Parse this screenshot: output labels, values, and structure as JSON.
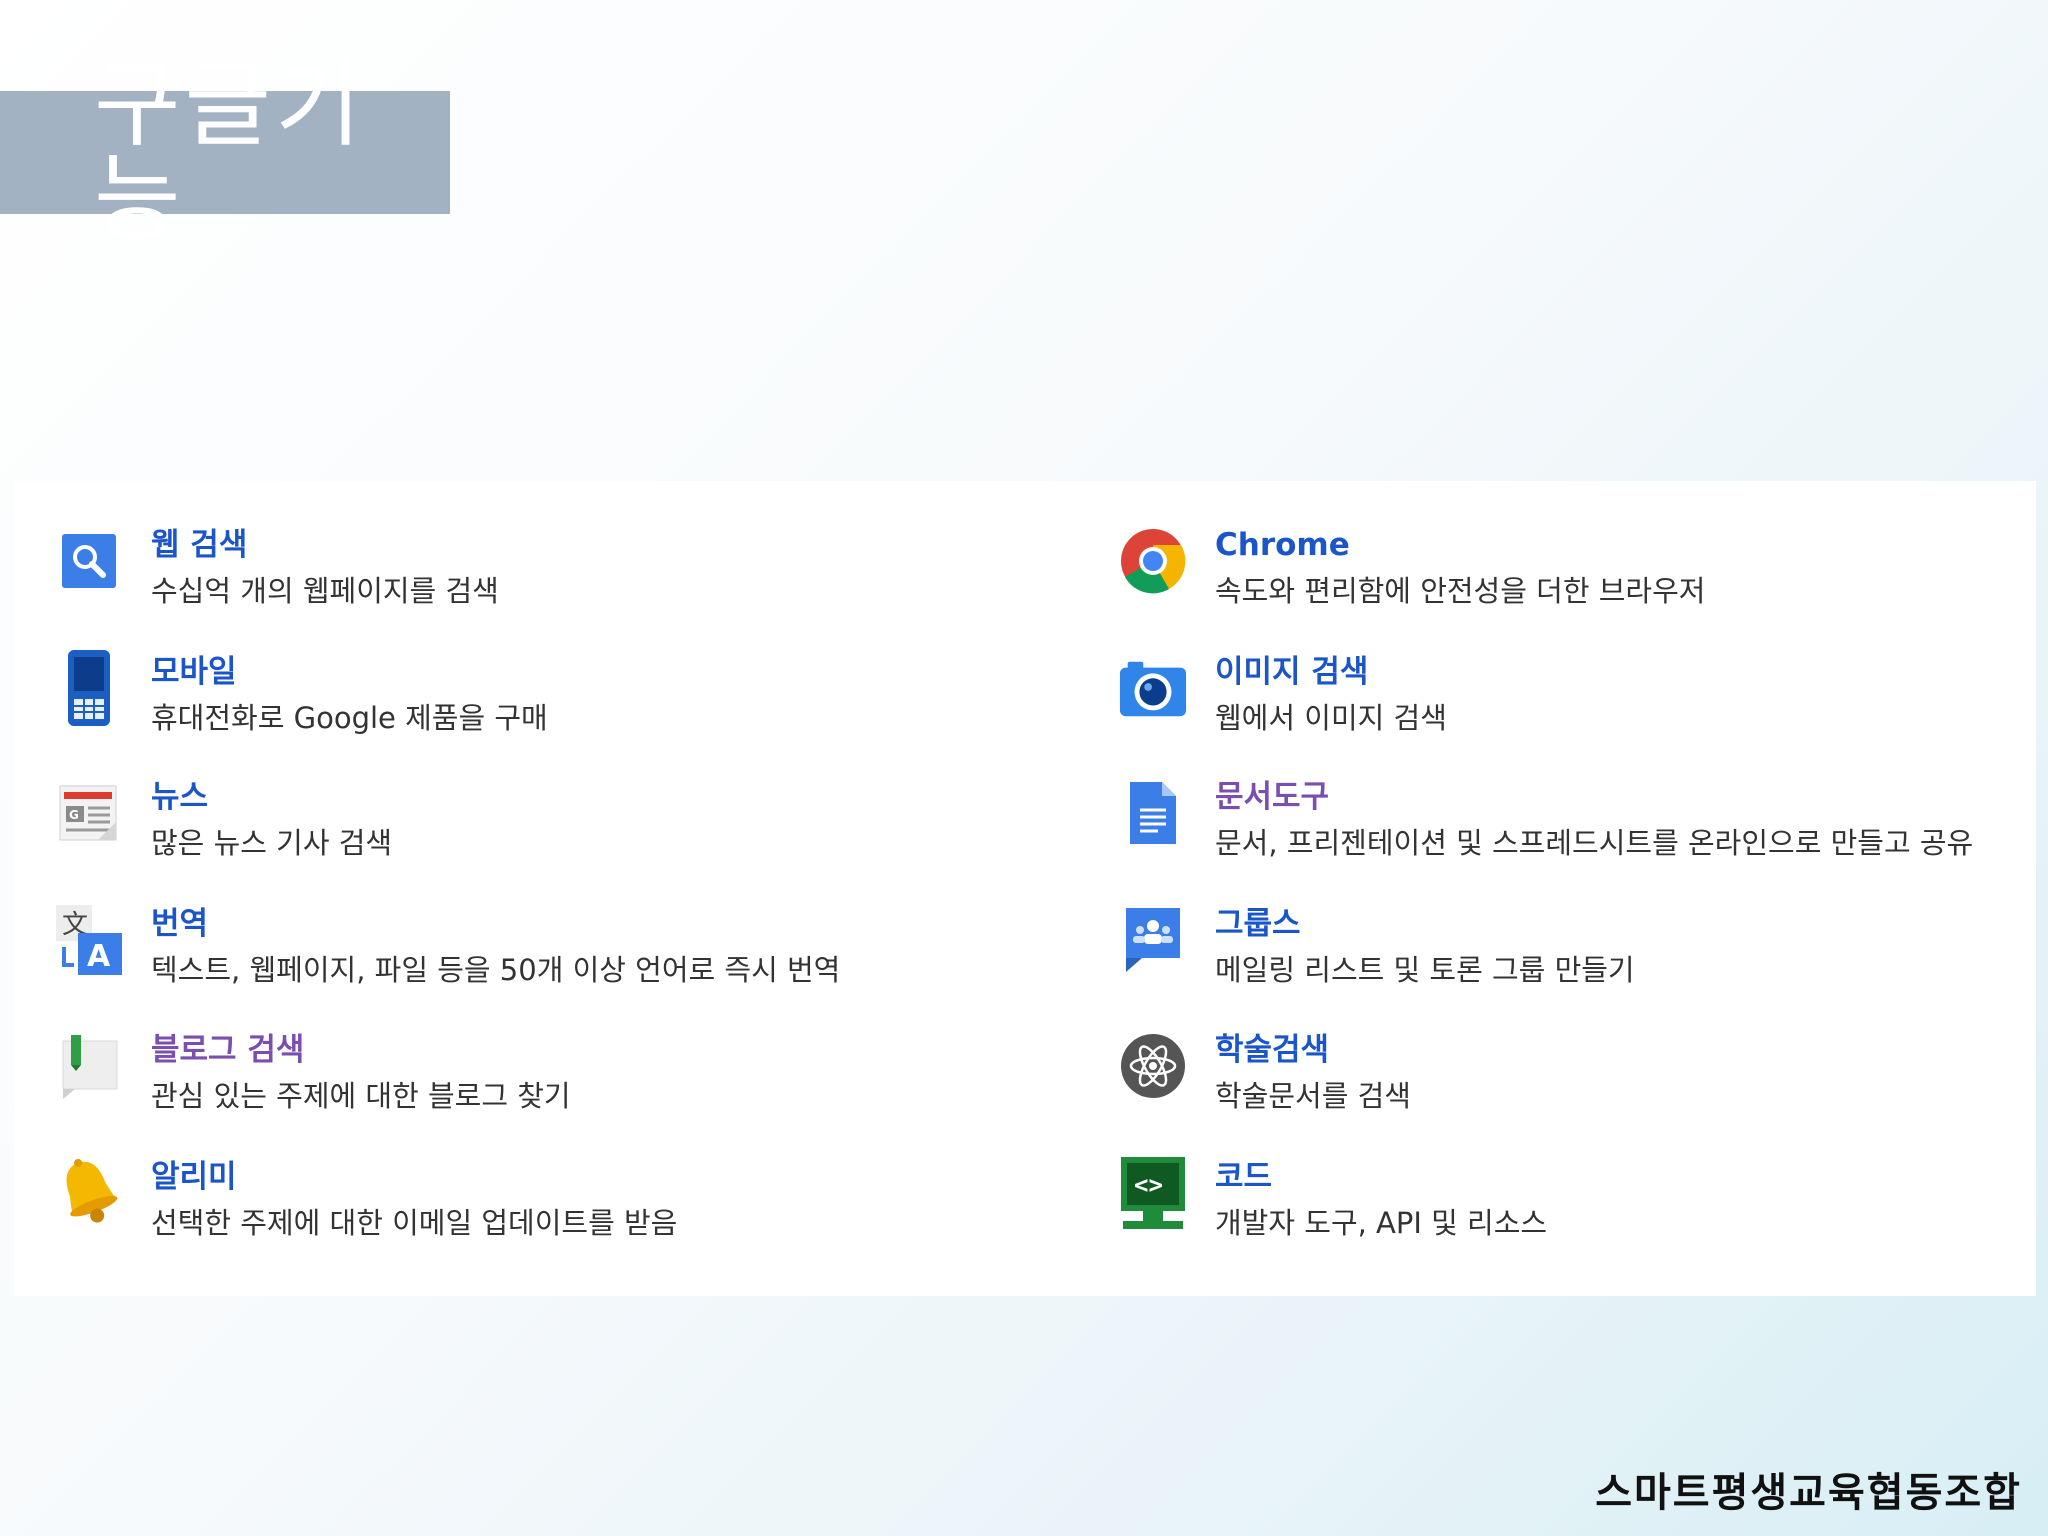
{
  "slide": {
    "title": "구글기능",
    "footer": "스마트평생교육협동조합"
  },
  "services_left": [
    {
      "title": "웹 검색",
      "desc": "수십억 개의 웹페이지를 검색",
      "icon": "search-icon"
    },
    {
      "title": "모바일",
      "desc": "휴대전화로 Google 제품을 구매",
      "icon": "mobile-phone-icon"
    },
    {
      "title": "뉴스",
      "desc": "많은 뉴스 기사 검색",
      "icon": "newspaper-icon"
    },
    {
      "title": "번역",
      "desc": "텍스트, 웹페이지, 파일 등을 50개 이상 언어로 즉시 번역",
      "icon": "translate-icon"
    },
    {
      "title": "블로그 검색",
      "desc": "관심 있는 주제에 대한 블로그 찾기",
      "icon": "blog-icon"
    },
    {
      "title": "알리미",
      "desc": "선택한 주제에 대한 이메일 업데이트를 받음",
      "icon": "bell-icon"
    }
  ],
  "services_right": [
    {
      "title": "Chrome",
      "desc": "속도와 편리함에 안전성을 더한 브라우저",
      "icon": "chrome-icon"
    },
    {
      "title": "이미지 검색",
      "desc": "웹에서 이미지 검색",
      "icon": "camera-icon"
    },
    {
      "title": "문서도구",
      "desc": "문서, 프리젠테이션 및 스프레드시트를 온라인으로 만들고 공유",
      "icon": "document-icon"
    },
    {
      "title": "그룹스",
      "desc": "메일링 리스트 및 토론 그룹 만들기",
      "icon": "groups-icon"
    },
    {
      "title": "학술검색",
      "desc": "학술문서를 검색",
      "icon": "atom-icon"
    },
    {
      "title": "코드",
      "desc": "개발자 도구, API 및 리소스",
      "icon": "code-monitor-icon"
    }
  ],
  "colors": {
    "title_bar": "#a3b2c2",
    "link": "#1a55c9",
    "link_visited": "#7a4fb0"
  }
}
